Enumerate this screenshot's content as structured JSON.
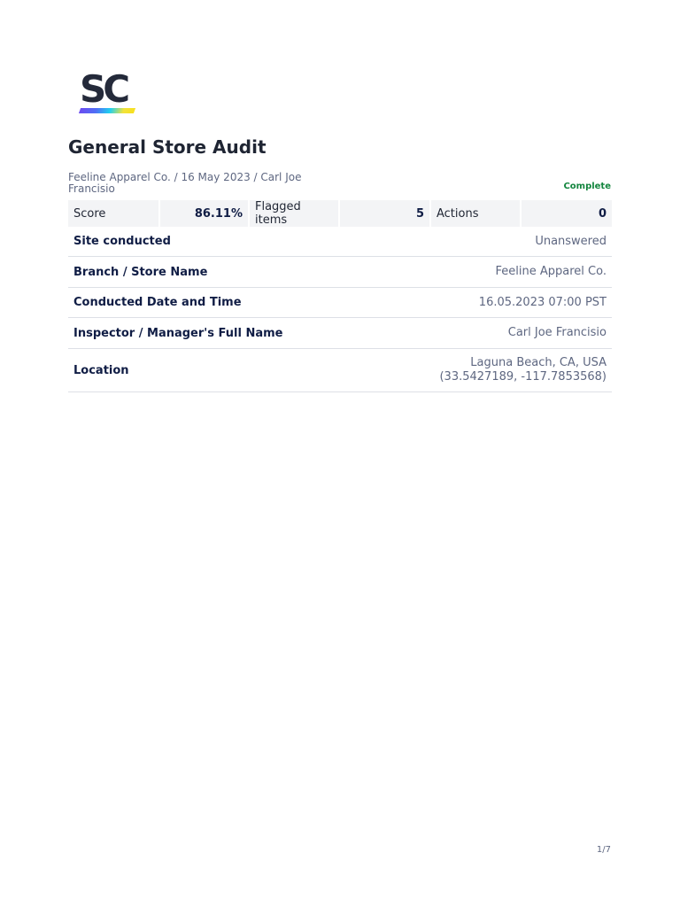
{
  "logo": {
    "text": "SC"
  },
  "title": "General Store Audit",
  "meta": "Feeline Apparel Co. / 16 May 2023 / Carl Joe Francisio",
  "status": "Complete",
  "status_color": "#13853e",
  "summary": {
    "score_label": "Score",
    "score_value": "86.11%",
    "flagged_label": "Flagged items",
    "flagged_value": "5",
    "actions_label": "Actions",
    "actions_value": "0"
  },
  "rows": [
    {
      "label": "Site conducted",
      "value": "Unanswered"
    },
    {
      "label": "Branch / Store Name",
      "value": "Feeline Apparel Co."
    },
    {
      "label": "Conducted Date and Time",
      "value": "16.05.2023 07:00 PST"
    },
    {
      "label": "Inspector / Manager's Full Name",
      "value": "Carl Joe Francisio"
    },
    {
      "label": "Location",
      "value": "Laguna Beach, CA, USA",
      "value2": "(33.5427189, -117.7853568)"
    }
  ],
  "page_number": "1/7"
}
